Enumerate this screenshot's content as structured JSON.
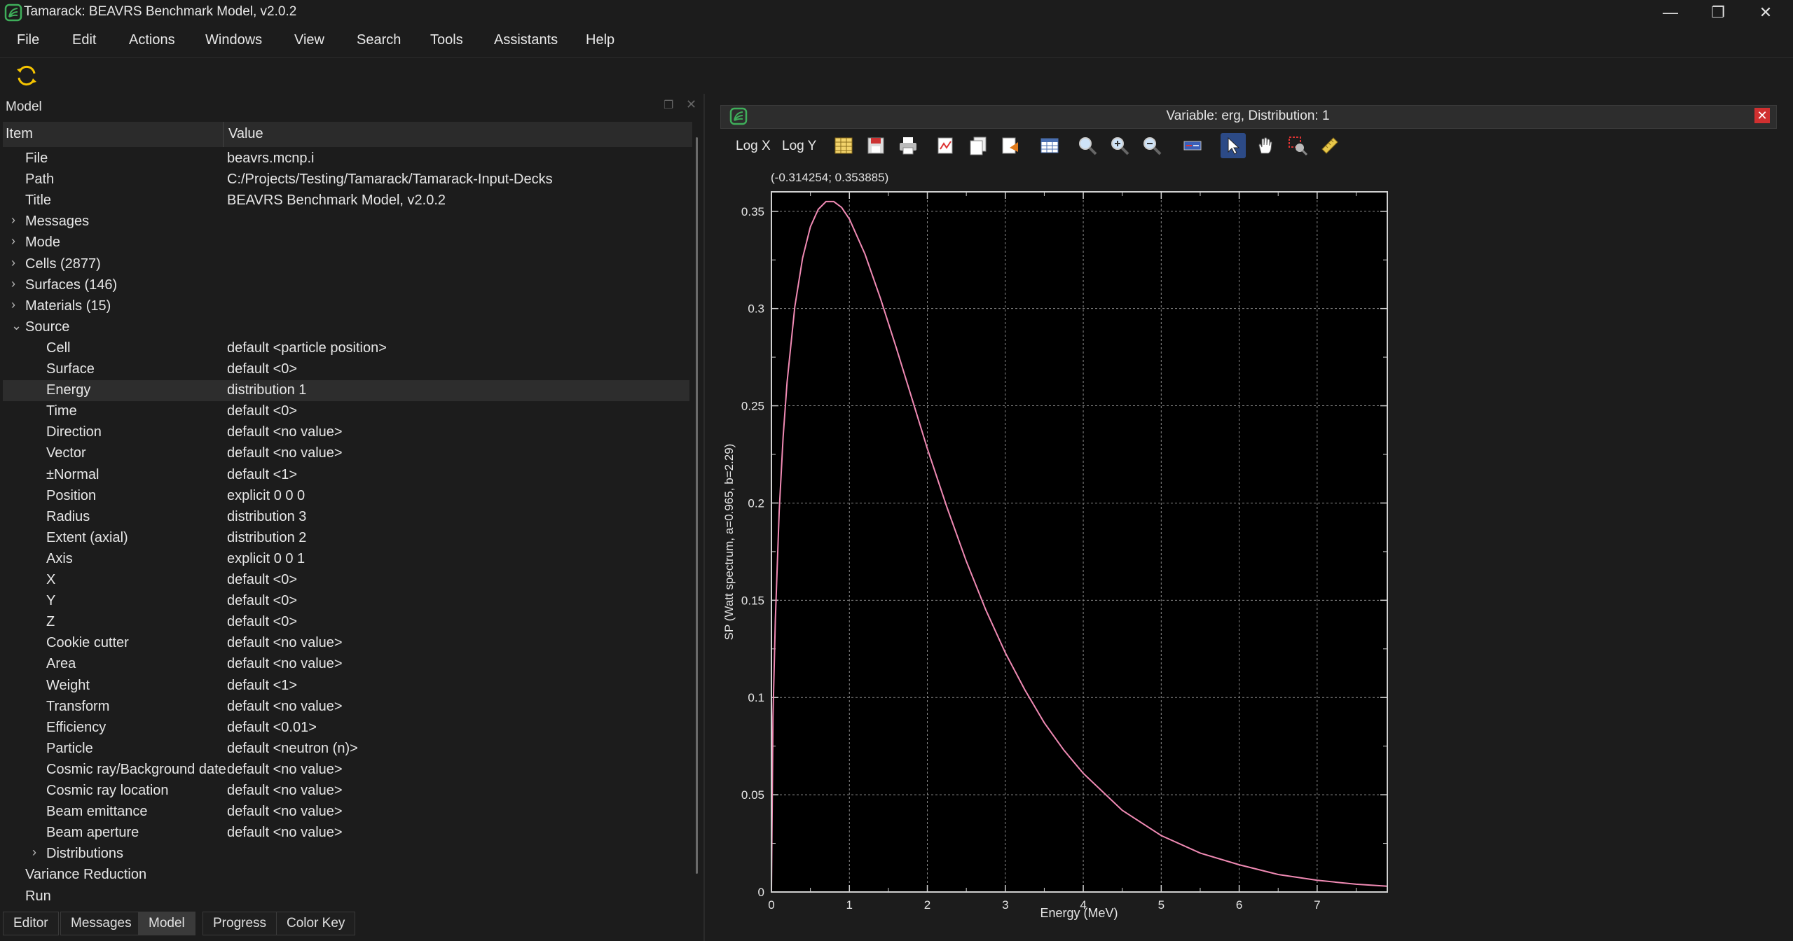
{
  "window": {
    "title": "Tamarack: BEAVRS Benchmark Model, v2.0.2",
    "controls": [
      "minimize",
      "restore",
      "close"
    ]
  },
  "menu": [
    "File",
    "Edit",
    "Actions",
    "Windows",
    "View",
    "Search",
    "Tools",
    "Assistants",
    "Help"
  ],
  "toolbar": {
    "icons": [
      "refresh-icon"
    ]
  },
  "model_panel": {
    "title": "Model",
    "columns": {
      "item": "Item",
      "value": "Value"
    },
    "rows": [
      {
        "item": "File",
        "value": "beavrs.mcnp.i",
        "indent": 1,
        "expander": ""
      },
      {
        "item": "Path",
        "value": "C:/Projects/Testing/Tamarack/Tamarack-Input-Decks",
        "indent": 1,
        "expander": ""
      },
      {
        "item": "Title",
        "value": "BEAVRS Benchmark Model, v2.0.2",
        "indent": 1,
        "expander": ""
      },
      {
        "item": "Messages",
        "value": "",
        "indent": 1,
        "expander": "›"
      },
      {
        "item": "Mode",
        "value": "",
        "indent": 1,
        "expander": "›"
      },
      {
        "item": "Cells (2877)",
        "value": "",
        "indent": 1,
        "expander": "›"
      },
      {
        "item": "Surfaces (146)",
        "value": "",
        "indent": 1,
        "expander": "›"
      },
      {
        "item": "Materials (15)",
        "value": "",
        "indent": 1,
        "expander": "›"
      },
      {
        "item": "Source",
        "value": "",
        "indent": 1,
        "expander": "⌄"
      },
      {
        "item": "Cell",
        "value": "default <particle position>",
        "indent": 2,
        "expander": ""
      },
      {
        "item": "Surface",
        "value": "default <0>",
        "indent": 2,
        "expander": ""
      },
      {
        "item": "Energy",
        "value": "distribution 1",
        "indent": 2,
        "expander": "",
        "selected": true
      },
      {
        "item": "Time",
        "value": "default <0>",
        "indent": 2,
        "expander": ""
      },
      {
        "item": "Direction",
        "value": "default <no value>",
        "indent": 2,
        "expander": ""
      },
      {
        "item": "Vector",
        "value": "default <no value>",
        "indent": 2,
        "expander": ""
      },
      {
        "item": "±Normal",
        "value": "default <1>",
        "indent": 2,
        "expander": ""
      },
      {
        "item": "Position",
        "value": "explicit 0 0 0",
        "indent": 2,
        "expander": ""
      },
      {
        "item": "Radius",
        "value": "distribution 3",
        "indent": 2,
        "expander": ""
      },
      {
        "item": "Extent (axial)",
        "value": "distribution 2",
        "indent": 2,
        "expander": ""
      },
      {
        "item": "Axis",
        "value": "explicit 0 0 1",
        "indent": 2,
        "expander": ""
      },
      {
        "item": "X",
        "value": "default <0>",
        "indent": 2,
        "expander": ""
      },
      {
        "item": "Y",
        "value": "default <0>",
        "indent": 2,
        "expander": ""
      },
      {
        "item": "Z",
        "value": "default <0>",
        "indent": 2,
        "expander": ""
      },
      {
        "item": "Cookie cutter",
        "value": "default <no value>",
        "indent": 2,
        "expander": ""
      },
      {
        "item": "Area",
        "value": "default <no value>",
        "indent": 2,
        "expander": ""
      },
      {
        "item": "Weight",
        "value": "default <1>",
        "indent": 2,
        "expander": ""
      },
      {
        "item": "Transform",
        "value": "default <no value>",
        "indent": 2,
        "expander": ""
      },
      {
        "item": "Efficiency",
        "value": "default <0.01>",
        "indent": 2,
        "expander": ""
      },
      {
        "item": "Particle",
        "value": "default <neutron (n)>",
        "indent": 2,
        "expander": ""
      },
      {
        "item": "Cosmic ray/Background date",
        "value": "default <no value>",
        "indent": 2,
        "expander": ""
      },
      {
        "item": "Cosmic ray location",
        "value": "default <no value>",
        "indent": 2,
        "expander": ""
      },
      {
        "item": "Beam emittance",
        "value": "default <no value>",
        "indent": 2,
        "expander": ""
      },
      {
        "item": "Beam aperture",
        "value": "default <no value>",
        "indent": 2,
        "expander": ""
      },
      {
        "item": "Distributions",
        "value": "",
        "indent": 2,
        "expander": "›"
      },
      {
        "item": "Variance Reduction",
        "value": "",
        "indent": 1,
        "expander": ""
      },
      {
        "item": "Run",
        "value": "",
        "indent": 1,
        "expander": ""
      }
    ]
  },
  "bottom_tabs": [
    {
      "label": "Editor",
      "active": false
    },
    {
      "label": "Messages",
      "active": false
    },
    {
      "label": "Model",
      "active": true
    },
    {
      "label": "Progress",
      "active": false
    },
    {
      "label": "Color Key",
      "active": false
    }
  ],
  "plot_window": {
    "title": "Variable: erg, Distribution: 1",
    "toolbar_text": [
      "Log X",
      "Log Y"
    ],
    "toolbar_icons": [
      "table-icon",
      "save-icon",
      "print-icon",
      "export-image-icon",
      "copy-icon",
      "export-data-icon",
      "grid-icon",
      "zoom-icon",
      "zoom-in-icon",
      "zoom-out-icon",
      "legend-icon",
      "pointer-icon",
      "pan-hand-icon",
      "zoom-box-icon",
      "ruler-icon"
    ],
    "active_tool": "pointer-icon",
    "coordinate_readout": "(-0.314254; 0.353885)"
  },
  "chart_data": {
    "type": "line",
    "title": "",
    "xlabel": "Energy (MeV)",
    "ylabel": "SP (Watt spectrum, a=0.965, b=2.29)",
    "xlim": [
      0,
      7.9
    ],
    "ylim": [
      0,
      0.36
    ],
    "xticks": [
      0,
      1,
      2,
      3,
      4,
      5,
      6,
      7
    ],
    "yticks": [
      0,
      0.05,
      0.1,
      0.15,
      0.2,
      0.25,
      0.3,
      0.35
    ],
    "grid": true,
    "background": "#000000",
    "line_color": "#f08ab4",
    "series": [
      {
        "x": [
          0,
          0.02,
          0.05,
          0.1,
          0.15,
          0.2,
          0.3,
          0.4,
          0.5,
          0.6,
          0.7,
          0.8,
          0.9,
          1.0,
          1.2,
          1.4,
          1.6,
          1.8,
          2.0,
          2.25,
          2.5,
          2.75,
          3.0,
          3.25,
          3.5,
          3.75,
          4.0,
          4.5,
          5.0,
          5.5,
          6.0,
          6.5,
          7.0,
          7.5,
          7.9
        ],
        "y": [
          0,
          0.09,
          0.14,
          0.196,
          0.234,
          0.262,
          0.301,
          0.326,
          0.342,
          0.351,
          0.355,
          0.355,
          0.352,
          0.346,
          0.328,
          0.305,
          0.28,
          0.254,
          0.228,
          0.198,
          0.17,
          0.145,
          0.123,
          0.104,
          0.087,
          0.073,
          0.061,
          0.042,
          0.029,
          0.02,
          0.014,
          0.009,
          0.006,
          0.004,
          0.003
        ]
      }
    ]
  }
}
